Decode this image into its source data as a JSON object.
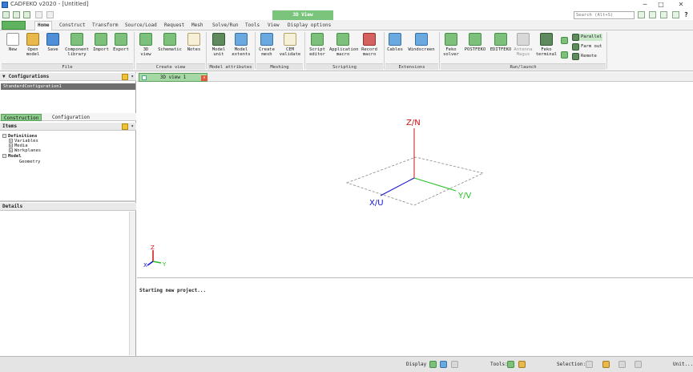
{
  "window": {
    "title": "CADFEKO v2020 - [Untitled]"
  },
  "context_tab": "3D View",
  "search": {
    "placeholder": "Search (Alt+S)"
  },
  "tabs": [
    "Home",
    "Construct",
    "Transform",
    "Source/Load",
    "Request",
    "Mesh",
    "Solve/Run",
    "Tools",
    "View",
    "Display options"
  ],
  "ribbon": {
    "file": {
      "label": "File",
      "new": "New",
      "open": "Open model",
      "save": "Save",
      "component": "Component library",
      "import": "Import",
      "export": "Export"
    },
    "create_view": {
      "label": "Create view",
      "view3d": "3D view",
      "schematic": "Schematic",
      "notes": "Notes"
    },
    "model_attr": {
      "label": "Model attributes",
      "unit": "Model unit",
      "extents": "Model extents"
    },
    "meshing": {
      "label": "Meshing",
      "create": "Create mesh",
      "cem": "CEM validate"
    },
    "scripting": {
      "label": "Scripting",
      "editor": "Script editor",
      "app_macro": "Application macro",
      "record": "Record macro"
    },
    "extensions": {
      "label": "Extensions",
      "cables": "Cables",
      "windscreen": "Windscreen"
    },
    "run_launch": {
      "label": "Run/launch",
      "feko": "Feko solver",
      "postfeko": "POSTFEKO",
      "editfeko": "EDITFEKO",
      "antenna": "Antenna Magus",
      "terminal": "Feko terminal",
      "parallel": "Parallel",
      "farmout": "Farm out",
      "remote": "Remote"
    }
  },
  "configurations": {
    "header": "Configurations",
    "item": "StandardConfiguration1"
  },
  "subtabs": [
    "Construction",
    "Configuration"
  ],
  "items": {
    "header": "Items",
    "definitions": "Definitions",
    "variables": "Variables",
    "media": "Media",
    "workplanes": "Workplanes",
    "model": "Model",
    "geometry": "Geometry"
  },
  "details": {
    "header": "Details"
  },
  "view": {
    "tab": "3D view 1",
    "axis_z": "Z/N",
    "axis_y": "Y/V",
    "axis_x": "X/U",
    "mini_z": "Z",
    "mini_y": "Y",
    "mini_x": "X"
  },
  "message": "Starting new project...",
  "status": {
    "display": "Display",
    "tools": "Tools:",
    "selection": "Selection:",
    "unit": "Unit..."
  },
  "colors": {
    "axis_z": "#d01010",
    "axis_y": "#20c020",
    "axis_x": "#1010d0",
    "accent": "#7bc47b"
  }
}
